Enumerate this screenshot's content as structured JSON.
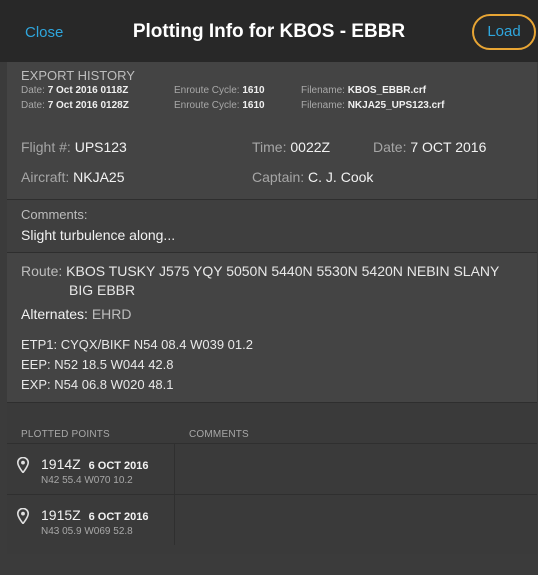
{
  "header": {
    "close_label": "Close",
    "title": "Plotting Info for KBOS - EBBR",
    "load_label": "Load"
  },
  "export_history": {
    "title": "EXPORT HISTORY",
    "rows": [
      {
        "date_label": "Date:",
        "date": "7 Oct 2016 0118Z",
        "cycle_label": "Enroute Cycle:",
        "cycle": "1610",
        "file_label": "Filename:",
        "file": "KBOS_EBBR.crf"
      },
      {
        "date_label": "Date:",
        "date": "7 Oct 2016 0128Z",
        "cycle_label": "Enroute Cycle:",
        "cycle": "1610",
        "file_label": "Filename:",
        "file": "NKJA25_UPS123.crf"
      }
    ]
  },
  "flight": {
    "flight_label": "Flight #:",
    "flight": "UPS123",
    "time_label": "Time:",
    "time": "0022Z",
    "date_label": "Date:",
    "date": "7 OCT 2016",
    "aircraft_label": "Aircraft:",
    "aircraft": "NKJA25",
    "captain_label": "Captain:",
    "captain": "C. J. Cook"
  },
  "comments": {
    "label": "Comments:",
    "text": "Slight turbulence along..."
  },
  "route": {
    "route_label": "Route:",
    "route_line1": "KBOS TUSKY J575 YQY 5050N 5440N 5530N 5420N NEBIN SLANY",
    "route_line2": "BIG EBBR",
    "alternates_label": "Alternates:",
    "alternates": "EHRD",
    "etp_label": "ETP1:",
    "etp": "CYQX/BIKF N54 08.4 W039 01.2",
    "eep_label": "EEP:",
    "eep": "N52 18.5 W044 42.8",
    "exp_label": "EXP:",
    "exp": "N54 06.8 W020 48.1"
  },
  "points": {
    "col_points": "PLOTTED POINTS",
    "col_comments": "COMMENTS",
    "items": [
      {
        "time": "1914Z",
        "date": "6 OCT 2016",
        "coord": "N42 55.4 W070 10.2",
        "comment": ""
      },
      {
        "time": "1915Z",
        "date": "6 OCT 2016",
        "coord": "N43 05.9 W069 52.8",
        "comment": ""
      }
    ]
  },
  "icons": {
    "pin": "map-pin-icon"
  },
  "colors": {
    "accent": "#2fa6dd",
    "highlight_ring": "#e8a534",
    "header_bg": "#282828",
    "panel_bg": "#444444"
  }
}
